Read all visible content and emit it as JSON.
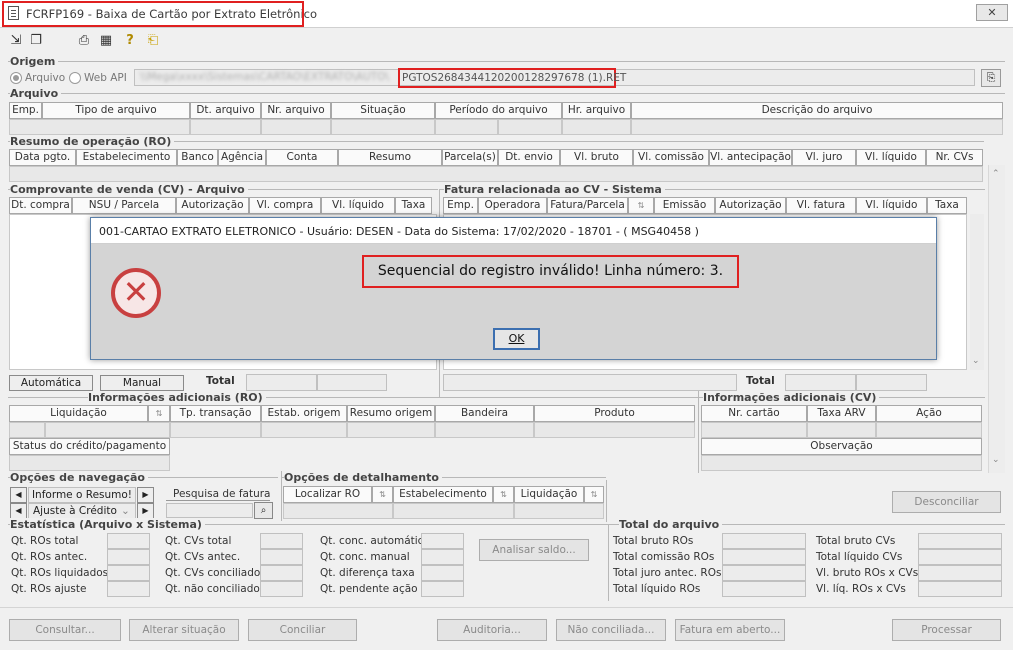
{
  "window": {
    "title": "FCRFP169 - Baixa de Cartão por Extrato Eletrônico",
    "close": "✕"
  },
  "origem": {
    "label": "Origem",
    "radio_arquivo": "Arquivo",
    "radio_webapi": "Web API",
    "path_prefix": "\\\\Mega\\xxxx\\Sistemas\\CARTAO\\EXTRATO\\AUTO\\",
    "filename": "PGTOS2684344120200128297678 (1).RET"
  },
  "arquivo": {
    "label": "Arquivo",
    "columns": [
      "Emp.",
      "Tipo de arquivo",
      "Dt. arquivo",
      "Nr. arquivo",
      "Situação",
      "Período do arquivo",
      "Hr. arquivo",
      "Descrição do arquivo"
    ]
  },
  "resumo": {
    "label": "Resumo de operação (RO)",
    "columns": [
      "Data pgto.",
      "Estabelecimento",
      "Banco",
      "Agência",
      "Conta",
      "Resumo",
      "Parcela(s)",
      "Dt. envio",
      "Vl. bruto",
      "Vl. comissão",
      "Vl. antecipação",
      "Vl. juro",
      "Vl. líquido",
      "Nr. CVs"
    ]
  },
  "comprovante": {
    "label": "Comprovante de venda (CV) - Arquivo",
    "columns": [
      "Dt. compra",
      "NSU / Parcela",
      "Autorização",
      "Vl. compra",
      "Vl. líquido",
      "Taxa"
    ]
  },
  "fatura": {
    "label": "Fatura relacionada ao CV - Sistema",
    "columns": [
      "Emp.",
      "Operadora",
      "Fatura/Parcela",
      "⇅",
      "Emissão",
      "Autorização",
      "Vl. fatura",
      "Vl. líquido",
      "Taxa"
    ]
  },
  "toggle": {
    "automatica": "Automática",
    "manual": "Manual",
    "total": "Total",
    "total2": "Total"
  },
  "info_ro": {
    "label": "Informações adicionais (RO)",
    "columns": [
      "Liquidação",
      "⇅",
      "Tp. transação",
      "Estab. origem",
      "Resumo origem",
      "Bandeira",
      "Produto"
    ],
    "status": "Status do crédito/pagamento"
  },
  "info_cv": {
    "label": "Informações adicionais (CV)",
    "columns": [
      "Nr. cartão",
      "Taxa ARV",
      "Ação"
    ],
    "observacao": "Observação"
  },
  "navegacao": {
    "label": "Opções de navegação",
    "informe": "Informe o Resumo!",
    "ajuste": "Ajuste à Crédito",
    "pesquisa": "Pesquisa de fatura",
    "prev": "◀",
    "next": "▶"
  },
  "detalhamento": {
    "label": "Opções de detalhamento",
    "localizar": "Localizar RO",
    "estabelecimento": "Estabelecimento",
    "liquidacao": "Liquidação"
  },
  "desconciliar": "Desconciliar",
  "estatistica": {
    "label": "Estatística (Arquivo x Sistema)",
    "col1": [
      "Qt. ROs total",
      "Qt. ROs antec.",
      "Qt. ROs liquidados",
      "Qt. ROs ajuste"
    ],
    "col2": [
      "Qt. CVs total",
      "Qt. CVs antec.",
      "Qt. CVs conciliado",
      "Qt. não conciliado"
    ],
    "col3": [
      "Qt. conc. automático",
      "Qt. conc. manual",
      "Qt. diferença taxa",
      "Qt. pendente ação"
    ],
    "analisar": "Analisar saldo..."
  },
  "total_arquivo": {
    "label": "Total do arquivo",
    "col1": [
      "Total bruto ROs",
      "Total comissão ROs",
      "Total juro antec. ROs",
      "Total líquido ROs"
    ],
    "col2": [
      "Total bruto CVs",
      "Total líquido CVs",
      "Vl. bruto ROs x CVs",
      "Vl. líq. ROs x CVs"
    ]
  },
  "actions": {
    "consultar": "Consultar...",
    "alterar": "Alterar situação",
    "conciliar": "Conciliar",
    "auditoria": "Auditoria...",
    "nao_conciliada": "Não conciliada...",
    "fatura_aberto": "Fatura em aberto...",
    "processar": "Processar"
  },
  "dialog": {
    "title": "001-CARTAO EXTRATO ELETRONICO - Usuário: DESEN - Data do Sistema: 17/02/2020 - 18701 - ( MSG40458 )",
    "message": "Sequencial do registro  inválido! Linha número: 3.",
    "ok": "OK"
  },
  "colors": {
    "highlight": "#e02020",
    "error": "#c84040",
    "focus": "#3c6fb0"
  }
}
